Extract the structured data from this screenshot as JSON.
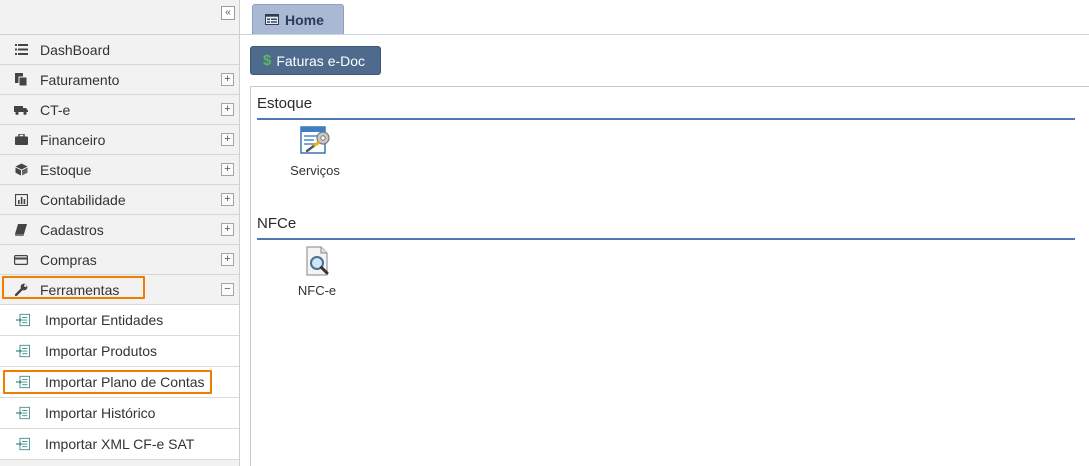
{
  "sidebar": {
    "collapse_label": "«",
    "items": [
      {
        "label": "DashBoard",
        "icon": "list-icon"
      },
      {
        "label": "Faturamento",
        "icon": "copy-icon"
      },
      {
        "label": "CT-e",
        "icon": "truck-icon"
      },
      {
        "label": "Financeiro",
        "icon": "briefcase-icon"
      },
      {
        "label": "Estoque",
        "icon": "cube-icon"
      },
      {
        "label": "Contabilidade",
        "icon": "bar-chart-icon"
      },
      {
        "label": "Cadastros",
        "icon": "book-icon"
      },
      {
        "label": "Compras",
        "icon": "credit-card-icon"
      },
      {
        "label": "Ferramentas",
        "icon": "wrench-icon"
      }
    ],
    "expand_symbol": "+",
    "collapse_symbol": "−",
    "subitems": [
      {
        "label": "Importar Entidades"
      },
      {
        "label": "Importar Produtos"
      },
      {
        "label": "Importar Plano de Contas"
      },
      {
        "label": "Importar Histórico"
      },
      {
        "label": "Importar XML CF-e SAT"
      }
    ]
  },
  "tabs": [
    {
      "label": "Home"
    }
  ],
  "toolbar": {
    "faturas_symbol": "$",
    "faturas_label": "Faturas e-Doc"
  },
  "sections": [
    {
      "title": "Estoque",
      "shortcuts": [
        {
          "label": "Serviços",
          "icon": "services-icon"
        }
      ]
    },
    {
      "title": "NFCe",
      "shortcuts": [
        {
          "label": "NFC-e",
          "icon": "document-search-icon"
        }
      ]
    }
  ],
  "colors": {
    "highlight": "#f07c00",
    "tab_bg": "#a9b9d3",
    "button_bg": "#4e6a8d",
    "section_rule": "#4f79b0"
  }
}
